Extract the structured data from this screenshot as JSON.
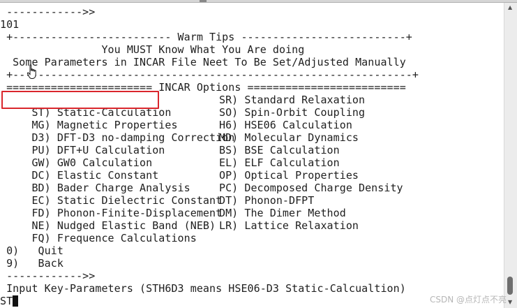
{
  "terminal": {
    "prompt_arrow_top": " ------------>>",
    "entered_value": "101",
    "warm_tips_header": " +------------------------- Warm Tips --------------------------+",
    "tip_1": "                You MUST Know What You Are doing",
    "tip_2": "  Some Parameters in INCAR File Neet To Be Set/Adjusted Manually",
    "tip_separator": " +---------------------------------------------------------------+",
    "incar_header": " ======================= INCAR Options =========================",
    "options": [
      {
        "left": " ST) Static-Calculation",
        "right": "SR) Standard Relaxation"
      },
      {
        "left": " MG) Magnetic Properties",
        "right": "SO) Spin-Orbit Coupling"
      },
      {
        "left": " D3) DFT-D3 no-damping Correction",
        "right": "H6) HSE06 Calculation"
      },
      {
        "left": " PU) DFT+U Calculation",
        "right": "MD) Molecular Dynamics"
      },
      {
        "left": " GW) GW0 Calculation",
        "right": "BS) BSE Calculation"
      },
      {
        "left": " DC) Elastic Constant",
        "right": "EL) ELF Calculation"
      },
      {
        "left": " BD) Bader Charge Analysis",
        "right": "OP) Optical Properties"
      },
      {
        "left": " EC) Static Dielectric Constant",
        "right": "PC) Decomposed Charge Density"
      },
      {
        "left": " FD) Phonon-Finite-Displacement",
        "right": "DT) Phonon-DFPT"
      },
      {
        "left": " NE) Nudged Elastic Band (NEB)",
        "right": "DM) The Dimer Method"
      },
      {
        "left": " FQ) Frequence Calculations",
        "right": "LR) Lattice Relaxation"
      }
    ],
    "quit_option": " 0)   Quit",
    "back_option": " 9)   Back",
    "prompt_arrow_bottom": " ------------>>",
    "input_prompt": " Input Key-Parameters (STH6D3 means HSE06-D3 Static-Calcualtion)",
    "typed_input": "ST"
  },
  "watermark": "CSDN @点灯点不亮",
  "colors": {
    "highlight": "#d9262c",
    "text": "#1e1e1e",
    "background": "#ffffff"
  },
  "icons": [
    "hand-pointer-icon",
    "scroll-up-arrow-icon",
    "scroll-down-arrow-icon"
  ]
}
